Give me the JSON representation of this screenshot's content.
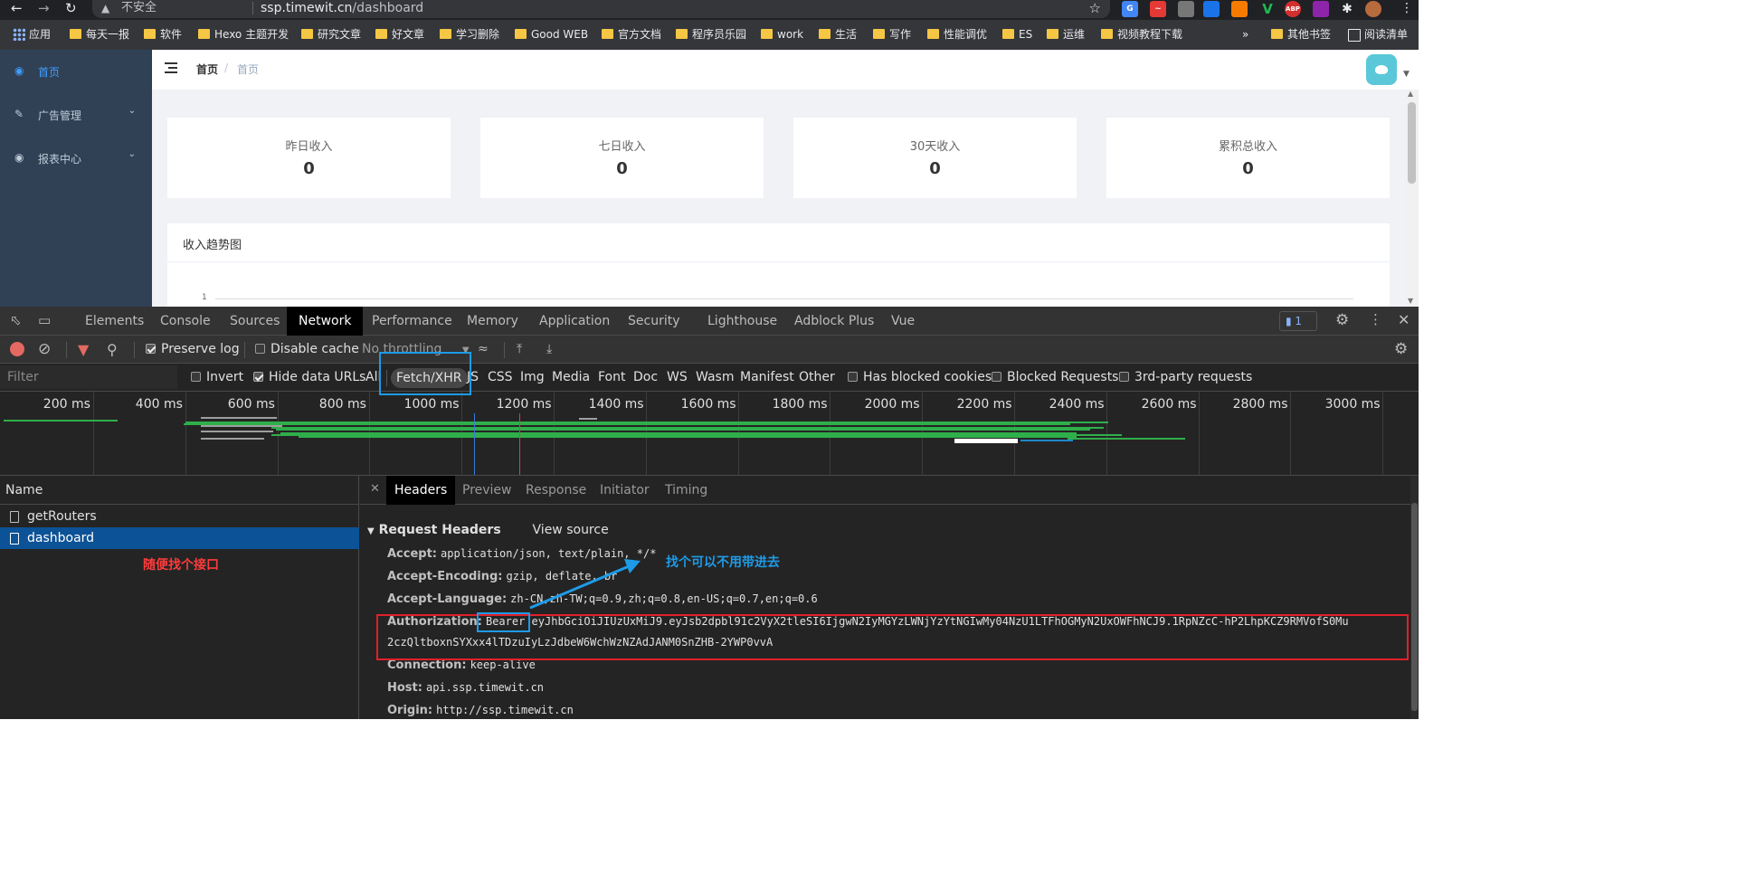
{
  "browser": {
    "insecure_label": "不安全",
    "url_host": "ssp.timewit.cn",
    "url_path": "/dashboard",
    "bookmarks": [
      "应用",
      "每天一报",
      "软件",
      "Hexo 主题开发",
      "研究文章",
      "好文章",
      "学习删除",
      "Good WEB",
      "官方文档",
      "程序员乐园",
      "work",
      "生活",
      "写作",
      "性能调优",
      "ES",
      "运维",
      "视频教程下载"
    ],
    "bookmarks_more": "»",
    "other_bookmarks": "其他书签",
    "reading_list": "阅读清单",
    "extensions": [
      "ABP",
      "V"
    ]
  },
  "sidebar": {
    "items": [
      {
        "label": "首页",
        "icon": "dashboard-icon"
      },
      {
        "label": "广告管理",
        "icon": "edit-icon"
      },
      {
        "label": "报表中心",
        "icon": "dashboard-icon"
      }
    ]
  },
  "navbar": {
    "breadcrumb_home": "首页",
    "breadcrumb_sep": "/",
    "breadcrumb_current": "首页"
  },
  "stats": [
    {
      "title": "昨日收入",
      "value": "0"
    },
    {
      "title": "七日收入",
      "value": "0"
    },
    {
      "title": "30天收入",
      "value": "0"
    },
    {
      "title": "累积总收入",
      "value": "0"
    }
  ],
  "chart": {
    "title": "收入趋势图",
    "y_tick": "1"
  },
  "devtools": {
    "tabs": [
      "Elements",
      "Console",
      "Sources",
      "Network",
      "Performance",
      "Memory",
      "Application",
      "Security",
      "Lighthouse",
      "Adblock Plus",
      "Vue"
    ],
    "active_tab": "Network",
    "issues_count": "1",
    "toolbar": {
      "preserve_log": "Preserve log",
      "disable_cache": "Disable cache",
      "throttling": "No throttling"
    },
    "filter": {
      "placeholder": "Filter",
      "invert": "Invert",
      "hide_data_urls": "Hide data URLs",
      "types": [
        "All",
        "Fetch/XHR",
        "JS",
        "CSS",
        "Img",
        "Media",
        "Font",
        "Doc",
        "WS",
        "Wasm",
        "Manifest",
        "Other"
      ],
      "selected_type": "Fetch/XHR",
      "has_blocked_cookies": "Has blocked cookies",
      "blocked_requests": "Blocked Requests",
      "third_party": "3rd-party requests"
    },
    "timeline": {
      "ticks": [
        "200 ms",
        "400 ms",
        "600 ms",
        "800 ms",
        "1000 ms",
        "1200 ms",
        "1400 ms",
        "1600 ms",
        "1800 ms",
        "2000 ms",
        "2200 ms",
        "2400 ms",
        "2600 ms",
        "2800 ms",
        "3000 ms"
      ]
    },
    "requests": {
      "column": "Name",
      "rows": [
        "getRouters",
        "dashboard"
      ],
      "selected": "dashboard"
    },
    "detail": {
      "tabs": [
        "Headers",
        "Preview",
        "Response",
        "Initiator",
        "Timing"
      ],
      "active_tab": "Headers",
      "section": "Request Headers",
      "view_source": "View source",
      "headers": [
        {
          "key": "Accept:",
          "value": "application/json, text/plain, */*"
        },
        {
          "key": "Accept-Encoding:",
          "value": "gzip, deflate, br"
        },
        {
          "key": "Accept-Language:",
          "value": "zh-CN,zh-TW;q=0.9,zh;q=0.8,en-US;q=0.7,en;q=0.6"
        },
        {
          "key": "Authorization:",
          "value": "Bearer eyJhbGciOiJIUzUxMiJ9.eyJsb2dpbl91c2VyX2tleSI6IjgwN2IyMGYzLWNjYzYtNGIwMy04NzU1LTFhOGMyN2UxOWFhNCJ9.1RpNZcC-hP2LhpKCZ9RMVofS0Mu"
        },
        {
          "key": "Connection:",
          "value": "keep-alive"
        },
        {
          "key": "Host:",
          "value": "api.ssp.timewit.cn"
        },
        {
          "key": "Origin:",
          "value": "http://ssp.timewit.cn"
        }
      ],
      "auth_continuation": "2czQltboxnSYXxx4lTDzuIyLzJdbeW6WchWzNZAdJANM0SnZHB-2YWP0vvA"
    }
  },
  "annotations": {
    "random_endpoint": "随便找个接口",
    "no_need": "找个可以不用带进去",
    "colors": {
      "red": "#e0202a",
      "blue": "#1e9be8"
    }
  }
}
